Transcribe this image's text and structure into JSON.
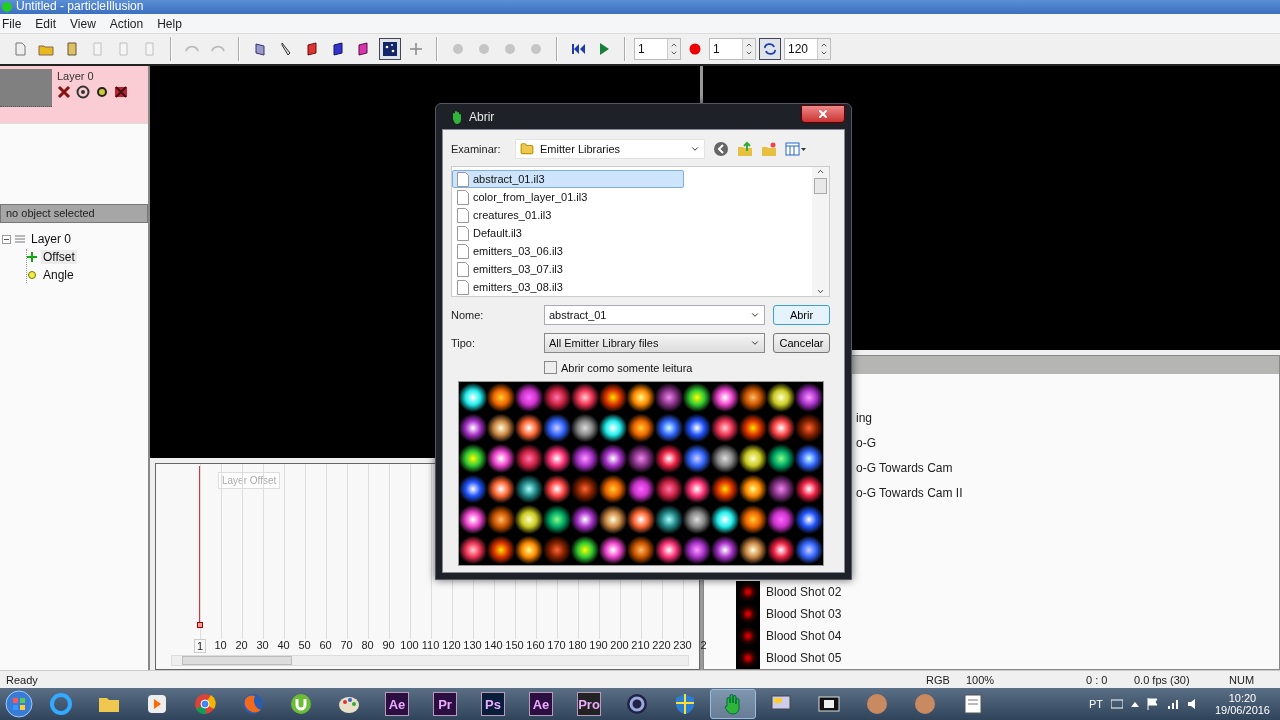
{
  "window": {
    "title": "Untitled - particleIllusion"
  },
  "menu": [
    "File",
    "Edit",
    "View",
    "Action",
    "Help"
  ],
  "toolbar": [
    {
      "kind": "new",
      "disabled": false,
      "pressed": false
    },
    {
      "kind": "open",
      "disabled": false,
      "pressed": false
    },
    {
      "kind": "save",
      "disabled": false,
      "pressed": false
    },
    {
      "kind": "cut",
      "disabled": true,
      "pressed": false
    },
    {
      "kind": "copy",
      "disabled": true,
      "pressed": false
    },
    {
      "kind": "paste",
      "disabled": true,
      "pressed": false
    },
    {
      "kind": "separator"
    },
    {
      "kind": "undo",
      "disabled": true,
      "pressed": false
    },
    {
      "kind": "redo",
      "disabled": true,
      "pressed": false
    },
    {
      "kind": "separator"
    },
    {
      "kind": "layer",
      "disabled": false,
      "pressed": false
    },
    {
      "kind": "pen",
      "disabled": false,
      "pressed": false
    },
    {
      "kind": "emitter-red",
      "disabled": false,
      "pressed": false
    },
    {
      "kind": "emitter-blue",
      "disabled": false,
      "pressed": false
    },
    {
      "kind": "emitter-pink",
      "disabled": false,
      "pressed": false
    },
    {
      "kind": "stars",
      "disabled": false,
      "pressed": true
    },
    {
      "kind": "move",
      "disabled": false,
      "pressed": false
    },
    {
      "kind": "separator"
    },
    {
      "kind": "prev-key",
      "disabled": true,
      "pressed": false
    },
    {
      "kind": "up-key",
      "disabled": true,
      "pressed": false
    },
    {
      "kind": "down-key",
      "disabled": true,
      "pressed": false
    },
    {
      "kind": "next-key",
      "disabled": true,
      "pressed": false
    },
    {
      "kind": "separator"
    },
    {
      "kind": "rewind",
      "disabled": false,
      "pressed": false
    },
    {
      "kind": "play",
      "disabled": false,
      "pressed": false
    },
    {
      "kind": "separator"
    },
    {
      "kind": "spinner",
      "value": "1"
    },
    {
      "kind": "record",
      "disabled": false,
      "pressed": false
    },
    {
      "kind": "spinner",
      "value": "1"
    },
    {
      "kind": "loop",
      "disabled": false,
      "pressed": true
    },
    {
      "kind": "spinner",
      "value": "120"
    }
  ],
  "layers": [
    {
      "name": "Layer 0",
      "selected": true
    }
  ],
  "selection_status": "no object selected",
  "tree": [
    {
      "label": "Layer 0",
      "kind": "layer",
      "selected": false,
      "expanded": true,
      "children": [
        {
          "label": "Offset",
          "kind": "offset",
          "selected": true
        },
        {
          "label": "Angle",
          "kind": "angle",
          "selected": false
        }
      ]
    }
  ],
  "timeline": {
    "track_label": "Layer Offset",
    "ruler": [
      {
        "label": "1",
        "current": true
      },
      {
        "label": "10",
        "current": false
      },
      {
        "label": "20",
        "current": false
      },
      {
        "label": "30",
        "current": false
      },
      {
        "label": "40",
        "current": false
      },
      {
        "label": "50",
        "current": false
      },
      {
        "label": "60",
        "current": false
      },
      {
        "label": "70",
        "current": false
      },
      {
        "label": "80",
        "current": false
      },
      {
        "label": "90",
        "current": false
      },
      {
        "label": "100",
        "current": false
      },
      {
        "label": "110",
        "current": false
      },
      {
        "label": "120",
        "current": false
      },
      {
        "label": "130",
        "current": false
      },
      {
        "label": "140",
        "current": false
      },
      {
        "label": "150",
        "current": false
      },
      {
        "label": "160",
        "current": false
      },
      {
        "label": "170",
        "current": false
      },
      {
        "label": "180",
        "current": false
      },
      {
        "label": "190",
        "current": false
      },
      {
        "label": "200",
        "current": false
      },
      {
        "label": "210",
        "current": false
      },
      {
        "label": "220",
        "current": false
      },
      {
        "label": "230",
        "current": false
      },
      {
        "label": "2",
        "current": false
      }
    ]
  },
  "emitter_panel": {
    "partial_rows": [
      "ing",
      "o-G",
      "o-G Towards Cam",
      "o-G Towards Cam II"
    ],
    "rows": [
      "Blood Shot 02",
      "Blood Shot 03",
      "Blood Shot 04",
      "Blood Shot 05"
    ]
  },
  "dialog": {
    "title": "Abrir",
    "look_in_label": "Examinar:",
    "look_in": "Emitter Libraries",
    "files": [
      {
        "name": "abstract_01.il3",
        "selected": true
      },
      {
        "name": "color_from_layer_01.il3",
        "selected": false
      },
      {
        "name": "creatures_01.il3",
        "selected": false
      },
      {
        "name": "Default.il3",
        "selected": false
      },
      {
        "name": "emitters_03_06.il3",
        "selected": false
      },
      {
        "name": "emitters_03_07.il3",
        "selected": false
      },
      {
        "name": "emitters_03_08.il3",
        "selected": false
      }
    ],
    "name_label": "Nome:",
    "name_value": "abstract_01",
    "type_label": "Tipo:",
    "type_value": "All Emitter Library files",
    "open_button": "Abrir",
    "cancel_button": "Cancelar",
    "read_only": {
      "label": "Abrir como somente leitura",
      "checked": false
    }
  },
  "status_bar": {
    "message": "Ready",
    "color_mode": "RGB",
    "zoom": "100%",
    "position": "0 : 0",
    "fps": "0.0 fps (30)",
    "num_lock": "NUM"
  },
  "taskbar": {
    "apps": [
      {
        "kind": "ie",
        "active": false
      },
      {
        "kind": "folder",
        "active": false
      },
      {
        "kind": "media",
        "active": false
      },
      {
        "kind": "chrome",
        "active": false
      },
      {
        "kind": "firefox",
        "active": false
      },
      {
        "kind": "torrent",
        "active": false
      },
      {
        "kind": "paint",
        "active": false
      },
      {
        "kind": "tile-purple",
        "label": "Ae",
        "active": false
      },
      {
        "kind": "tile-purple",
        "label": "Pr",
        "active": false
      },
      {
        "kind": "tile-blue",
        "label": "Ps",
        "active": false
      },
      {
        "kind": "tile-purple",
        "label": "Ae",
        "active": false
      },
      {
        "kind": "tile-dark",
        "label": "Pro",
        "active": false
      },
      {
        "kind": "sphere",
        "active": false
      },
      {
        "kind": "shield",
        "active": false
      },
      {
        "kind": "hand",
        "active": true
      },
      {
        "kind": "monitor",
        "active": false
      },
      {
        "kind": "film",
        "active": false
      },
      {
        "kind": "avatar",
        "active": false
      },
      {
        "kind": "avatar",
        "active": false
      },
      {
        "kind": "document",
        "active": false
      }
    ],
    "language": "PT",
    "time": "10:20",
    "date": "19/06/2016"
  }
}
